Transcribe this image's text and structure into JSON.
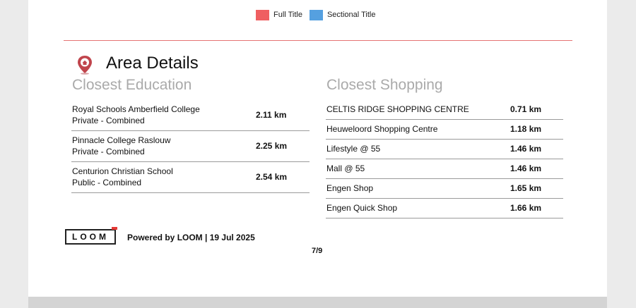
{
  "legend": {
    "items": [
      {
        "label": "Full Title",
        "color": "#ef5f61"
      },
      {
        "label": "Sectional Title",
        "color": "#55a0e0"
      }
    ]
  },
  "colors": {
    "rule": "#e57373",
    "pin": "#c0444c"
  },
  "section": {
    "title": "Area Details"
  },
  "education": {
    "heading": "Closest Education",
    "items": [
      {
        "name": "Royal Schools Amberfield College",
        "type": "Private - Combined",
        "distance": "2.11 km"
      },
      {
        "name": "Pinnacle College Raslouw",
        "type": "Private - Combined",
        "distance": "2.25 km"
      },
      {
        "name": "Centurion Christian School",
        "type": "Public - Combined",
        "distance": "2.54 km"
      }
    ]
  },
  "shopping": {
    "heading": "Closest Shopping",
    "items": [
      {
        "name": "CELTIS RIDGE SHOPPING CENTRE",
        "distance": "0.71 km"
      },
      {
        "name": "Heuweloord Shopping Centre",
        "distance": "1.18 km"
      },
      {
        "name": "Lifestyle @ 55",
        "distance": "1.46 km"
      },
      {
        "name": "Mall @ 55",
        "distance": "1.46 km"
      },
      {
        "name": "Engen Shop",
        "distance": "1.65 km"
      },
      {
        "name": "Engen Quick Shop",
        "distance": "1.66 km"
      }
    ]
  },
  "footer": {
    "logo": "LOOM",
    "powered": "Powered by LOOM | 19 Jul 2025",
    "page": "7/9"
  }
}
